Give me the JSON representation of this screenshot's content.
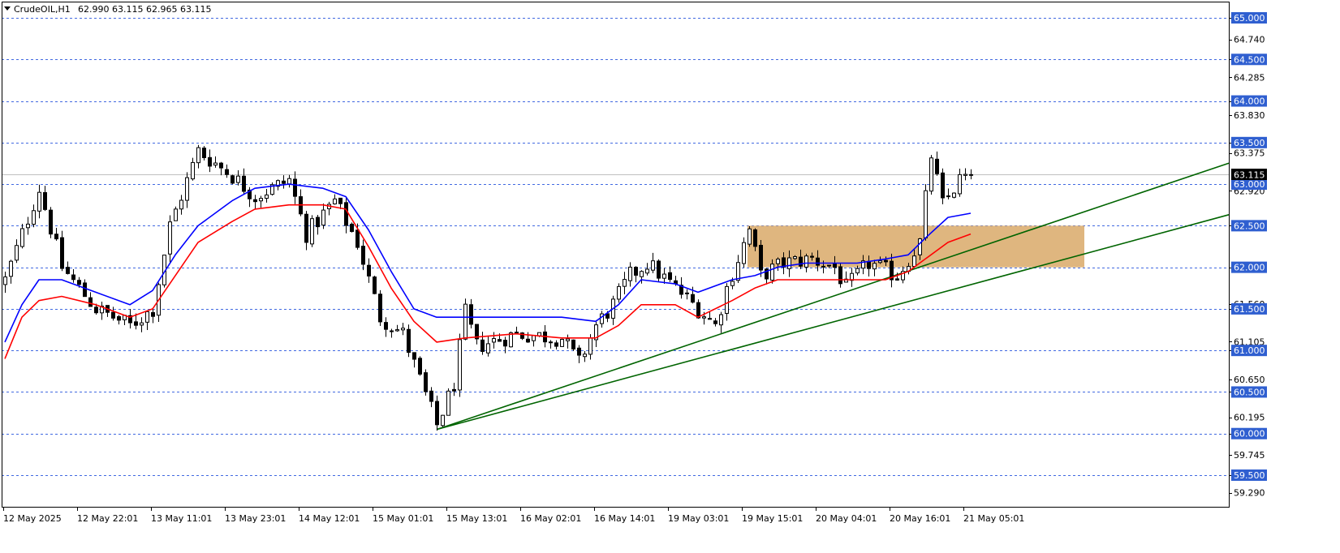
{
  "header": {
    "symbol": "CrudeOIL,H1",
    "ohlc": "62.990 63.115 62.965 63.115"
  },
  "colors": {
    "background": "#ffffff",
    "bull_candle": "#ffffff",
    "bear_candle": "#000000",
    "ma_fast": "#0000ff",
    "ma_slow": "#ff0000",
    "level_line": "#4169e1",
    "level_label_bg": "#2f5fd0",
    "trendline": "#006400",
    "zone_fill": "#d9a968",
    "current_price_bg": "#000000"
  },
  "chart_data": {
    "type": "candlestick",
    "symbol": "CrudeOIL",
    "timeframe": "H1",
    "y_axis": {
      "range": [
        59.1,
        65.2
      ],
      "ticks": [
        "65.000",
        "64.740",
        "64.500",
        "64.285",
        "64.000",
        "63.830",
        "63.500",
        "63.375",
        "62.920",
        "62.500",
        "62.000",
        "61.560",
        "61.500",
        "61.105",
        "61.000",
        "60.650",
        "60.500",
        "60.195",
        "60.000",
        "59.745",
        "59.500",
        "59.290"
      ],
      "level_labels": [
        "65.000",
        "64.500",
        "64.000",
        "63.500",
        "63.000",
        "62.500",
        "62.000",
        "61.500",
        "61.000",
        "60.500",
        "60.000",
        "59.500"
      ]
    },
    "x_axis": {
      "labels": [
        "12 May 2025",
        "12 May 22:01",
        "13 May 11:01",
        "13 May 23:01",
        "14 May 12:01",
        "15 May 01:01",
        "15 May 13:01",
        "16 May 02:01",
        "16 May 14:01",
        "19 May 03:01",
        "19 May 15:01",
        "20 May 04:01",
        "20 May 16:01",
        "21 May 05:01"
      ]
    },
    "current_price": "63.115",
    "horizontal_levels": [
      65.0,
      64.5,
      64.0,
      63.5,
      63.0,
      62.5,
      62.0,
      61.5,
      61.0,
      60.5,
      60.0,
      59.5
    ],
    "zone": {
      "price_low": 62.0,
      "price_high": 62.5,
      "from_candle": 131,
      "to_candle": 190
    },
    "trendlines": [
      {
        "from": {
          "candle": 76,
          "price": 60.05
        },
        "to": {
          "candle": 211,
          "price": 63.15
        }
      },
      {
        "from": {
          "candle": 76,
          "price": 60.05
        },
        "to": {
          "candle": 211,
          "price": 62.55
        }
      }
    ],
    "series": [
      {
        "name": "candles",
        "close_path": [
          [
            0,
            61.85
          ],
          [
            6,
            62.95
          ],
          [
            10,
            62.0
          ],
          [
            16,
            61.5
          ],
          [
            22,
            61.3
          ],
          [
            26,
            61.5
          ],
          [
            29,
            62.5
          ],
          [
            34,
            63.4
          ],
          [
            40,
            63.1
          ],
          [
            44,
            62.85
          ],
          [
            50,
            63.05
          ],
          [
            53,
            62.4
          ],
          [
            58,
            62.8
          ],
          [
            62,
            62.3
          ],
          [
            66,
            61.4
          ],
          [
            70,
            61.2
          ],
          [
            73,
            60.65
          ],
          [
            76,
            60.1
          ],
          [
            79,
            60.6
          ],
          [
            81,
            61.45
          ],
          [
            83,
            61.05
          ],
          [
            90,
            61.2
          ],
          [
            98,
            61.15
          ],
          [
            101,
            60.85
          ],
          [
            104,
            61.3
          ],
          [
            107,
            61.55
          ],
          [
            110,
            61.9
          ],
          [
            113,
            62.05
          ],
          [
            118,
            61.75
          ],
          [
            122,
            61.5
          ],
          [
            125,
            61.3
          ],
          [
            127,
            61.75
          ],
          [
            131,
            62.45
          ],
          [
            133,
            61.9
          ],
          [
            137,
            62.05
          ],
          [
            142,
            62.1
          ],
          [
            146,
            62.0
          ],
          [
            148,
            61.75
          ],
          [
            152,
            62.05
          ],
          [
            157,
            61.9
          ],
          [
            161,
            62.3
          ],
          [
            163,
            63.35
          ],
          [
            165,
            62.75
          ],
          [
            168,
            63.05
          ],
          [
            170,
            63.115
          ]
        ]
      },
      {
        "name": "ma_fast",
        "points": [
          [
            0,
            61.1
          ],
          [
            3,
            61.55
          ],
          [
            6,
            61.85
          ],
          [
            10,
            61.85
          ],
          [
            16,
            61.7
          ],
          [
            22,
            61.55
          ],
          [
            26,
            61.72
          ],
          [
            30,
            62.15
          ],
          [
            34,
            62.5
          ],
          [
            40,
            62.8
          ],
          [
            44,
            62.95
          ],
          [
            50,
            63.0
          ],
          [
            56,
            62.95
          ],
          [
            60,
            62.85
          ],
          [
            64,
            62.45
          ],
          [
            68,
            61.95
          ],
          [
            72,
            61.5
          ],
          [
            76,
            61.4
          ],
          [
            81,
            61.4
          ],
          [
            90,
            61.4
          ],
          [
            98,
            61.4
          ],
          [
            104,
            61.35
          ],
          [
            108,
            61.55
          ],
          [
            112,
            61.85
          ],
          [
            118,
            61.8
          ],
          [
            122,
            61.7
          ],
          [
            128,
            61.85
          ],
          [
            132,
            61.9
          ],
          [
            136,
            62.0
          ],
          [
            141,
            62.05
          ],
          [
            146,
            62.05
          ],
          [
            150,
            62.05
          ],
          [
            155,
            62.1
          ],
          [
            159,
            62.15
          ],
          [
            162,
            62.35
          ],
          [
            166,
            62.6
          ],
          [
            170,
            62.65
          ]
        ]
      },
      {
        "name": "ma_slow",
        "points": [
          [
            0,
            60.9
          ],
          [
            3,
            61.4
          ],
          [
            6,
            61.6
          ],
          [
            10,
            61.65
          ],
          [
            16,
            61.55
          ],
          [
            22,
            61.4
          ],
          [
            26,
            61.5
          ],
          [
            30,
            61.9
          ],
          [
            34,
            62.3
          ],
          [
            40,
            62.55
          ],
          [
            44,
            62.7
          ],
          [
            50,
            62.75
          ],
          [
            56,
            62.75
          ],
          [
            60,
            62.7
          ],
          [
            64,
            62.25
          ],
          [
            68,
            61.75
          ],
          [
            72,
            61.35
          ],
          [
            76,
            61.1
          ],
          [
            81,
            61.15
          ],
          [
            90,
            61.2
          ],
          [
            98,
            61.15
          ],
          [
            104,
            61.15
          ],
          [
            108,
            61.3
          ],
          [
            112,
            61.55
          ],
          [
            118,
            61.55
          ],
          [
            122,
            61.4
          ],
          [
            128,
            61.6
          ],
          [
            132,
            61.75
          ],
          [
            136,
            61.85
          ],
          [
            141,
            61.85
          ],
          [
            146,
            61.85
          ],
          [
            150,
            61.85
          ],
          [
            155,
            61.85
          ],
          [
            159,
            61.95
          ],
          [
            162,
            62.1
          ],
          [
            166,
            62.3
          ],
          [
            170,
            62.4
          ]
        ]
      }
    ]
  }
}
